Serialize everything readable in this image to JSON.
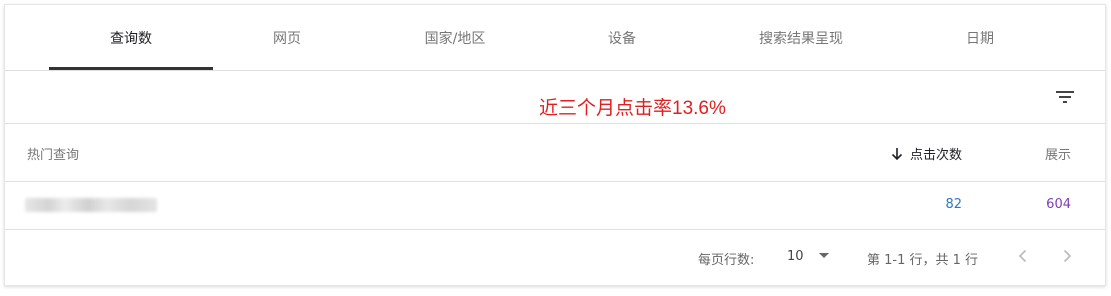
{
  "tabs": [
    {
      "label": "查询数",
      "active": true
    },
    {
      "label": "网页"
    },
    {
      "label": "国家/地区"
    },
    {
      "label": "设备"
    },
    {
      "label": "搜索结果呈现"
    },
    {
      "label": "日期"
    }
  ],
  "annotation": "近三个月点击率13.6%",
  "table": {
    "columns": {
      "query": "热门查询",
      "clicks": "点击次数",
      "impressions": "展示"
    },
    "sort": "clicks-descending",
    "rows": [
      {
        "query": "",
        "clicks": "82",
        "impressions": "604"
      }
    ]
  },
  "pagination": {
    "rows_per_page_label": "每页行数:",
    "rows_per_page_value": "10",
    "range_text": "第 1-1 行，共 1 行"
  },
  "icons": {
    "filter": "filter-icon",
    "sort": "arrow-down-icon",
    "dropdown": "caret-down-icon",
    "prev": "chevron-left-icon",
    "next": "chevron-right-icon"
  },
  "colors": {
    "annotation": "#e02020",
    "clicks_value": "#2b79c2",
    "impressions_value": "#7b3fb0",
    "active_tab_underline": "#333333"
  }
}
